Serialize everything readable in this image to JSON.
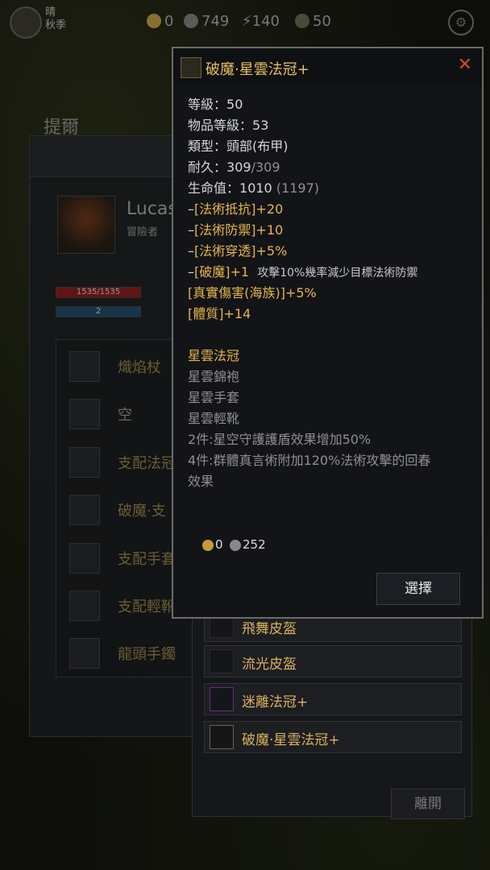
{
  "topbar": {
    "weather_line1": "晴",
    "weather_line2": "秋季",
    "gold": "0",
    "silver": "749",
    "energy": "140",
    "other": "50"
  },
  "background": {
    "title": "提爾",
    "hero_name": "Lucas",
    "hero_class": "冒險者",
    "hp_text": "1535/1535",
    "mp_text": "2",
    "equipment": [
      {
        "name": "熾焰杖"
      },
      {
        "name": "空"
      },
      {
        "name": "支配法冠"
      },
      {
        "name": "破魔·支"
      },
      {
        "name": "支配手套"
      },
      {
        "name": "支配輕靴"
      },
      {
        "name": "龍頭手鐲"
      }
    ],
    "list_items": [
      {
        "name": "飛舞皮盔"
      },
      {
        "name": "流光皮盔"
      },
      {
        "name": "迷離法冠+"
      },
      {
        "name": "破魔·星雲法冠+"
      }
    ],
    "leave_label": "離開"
  },
  "tooltip": {
    "title": "破魔·星雲法冠+",
    "close": "✕",
    "level_label": "等級：",
    "level_value": "50",
    "item_level_label": "物品等級：",
    "item_level_value": "53",
    "type_label": "類型：",
    "type_value": "頭部(布甲)",
    "durability_label": "耐久：",
    "durability_value": "309",
    "durability_max": "/309",
    "hp_label": "生命值：",
    "hp_value": "1010",
    "hp_total": "(1197)",
    "mods": [
      {
        "prefix": "–",
        "text": "[法術抵抗]+20"
      },
      {
        "prefix": "–",
        "text": "[法術防禦]+10"
      },
      {
        "prefix": "–",
        "text": "[法術穿透]+5%"
      }
    ],
    "special_prefix": "–",
    "special_name": "[破魔]+1",
    "special_desc": "攻擊10%幾率減少目標法術防禦",
    "true_damage": "[真實傷害(海族)]+5%",
    "constitution": "[體質]+14",
    "set_name": "星雲法冠",
    "set_items": [
      "星雲錦袍",
      "星雲手套",
      "星雲輕靴"
    ],
    "set_bonus_2": "2件:星空守護護盾效果增加50%",
    "set_bonus_4_line1": "4件:群體真言術附加120%法術攻擊的回春",
    "set_bonus_4_line2": "效果",
    "cost_gold": "0",
    "cost_silver": "252",
    "select_label": "選擇"
  }
}
